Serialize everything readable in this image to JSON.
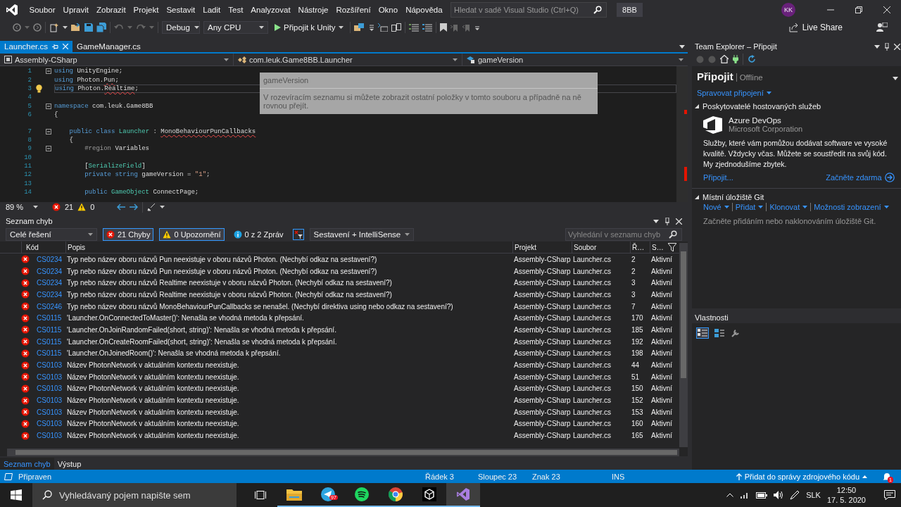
{
  "menu": {
    "items": [
      "Soubor",
      "Upravit",
      "Zobrazit",
      "Projekt",
      "Sestavit",
      "Ladit",
      "Test",
      "Analyzovat",
      "Nástroje",
      "Rozšíření",
      "Okno",
      "Nápověda"
    ]
  },
  "search": {
    "placeholder": "Hledat v sadě Visual Studio (Ctrl+Q)"
  },
  "solution": "8BB",
  "account": {
    "initials": "KK"
  },
  "toolbar": {
    "configuration": "Debug",
    "platform": "Any CPU",
    "run": "Připojit k Unity",
    "live_share": "Live Share"
  },
  "editor": {
    "tabs": [
      {
        "label": "Launcher.cs",
        "selected": true
      },
      {
        "label": "GameManager.cs",
        "selected": false
      }
    ],
    "nav": [
      "Assembly-CSharp",
      "com.leuk.Game8BB.Launcher",
      "gameVersion"
    ],
    "lines": [
      {
        "number": "1",
        "current": false,
        "fold": true,
        "tokens": [
          {
            "kind": "keyword",
            "text": "using"
          },
          {
            "kind": "plain",
            "text": " UnityEngine;"
          }
        ]
      },
      {
        "number": "2",
        "current": false,
        "fold": false,
        "tokens": [
          {
            "kind": "keyword",
            "text": "using"
          },
          {
            "kind": "plain",
            "text": " Photon."
          },
          {
            "kind": "unresolved",
            "text": "Pun"
          },
          {
            "kind": "plain",
            "text": ";"
          }
        ]
      },
      {
        "number": "3",
        "current": true,
        "fold": false,
        "tokens": [
          {
            "kind": "keyword",
            "text": "using"
          },
          {
            "kind": "plain",
            "text": " Photon."
          },
          {
            "kind": "unresolved",
            "text": "Realtime"
          },
          {
            "kind": "plain",
            "text": ";"
          }
        ]
      },
      {
        "number": "4",
        "current": false,
        "fold": false
      },
      {
        "number": "5",
        "current": false,
        "fold": true,
        "tokens": [
          {
            "kind": "keyword",
            "text": "namespace"
          },
          {
            "kind": "plain",
            "text": " com.leuk.Game8BB"
          }
        ]
      },
      {
        "number": "6",
        "current": false,
        "fold": false,
        "tokens": [
          {
            "kind": "plain",
            "text": "{"
          }
        ]
      },
      {
        "number": "7",
        "current": false,
        "fold": true,
        "tokens": [
          {
            "kind": "keyword",
            "text": "    public class "
          },
          {
            "kind": "type",
            "text": "Launcher"
          },
          {
            "kind": "plain",
            "text": " : "
          },
          {
            "kind": "unresolved",
            "text": "MonoBehaviourPunCallbacks"
          }
        ]
      },
      {
        "number": "8",
        "current": false,
        "fold": false,
        "tokens": [
          {
            "kind": "plain",
            "text": "    {"
          }
        ]
      },
      {
        "number": "9",
        "current": false,
        "fold": true,
        "tokens": [
          {
            "kind": "region",
            "text": "        #region"
          },
          {
            "kind": "plain",
            "text": " Variables"
          }
        ]
      },
      {
        "number": "10",
        "current": false,
        "fold": false
      },
      {
        "number": "11",
        "current": false,
        "fold": false,
        "tokens": [
          {
            "kind": "plain",
            "text": "        ["
          },
          {
            "kind": "type",
            "text": "SerializeField"
          },
          {
            "kind": "plain",
            "text": "]"
          }
        ]
      },
      {
        "number": "12",
        "current": false,
        "fold": false,
        "tokens": [
          {
            "kind": "keyword",
            "text": "        private string"
          },
          {
            "kind": "plain",
            "text": " gameVersion = "
          },
          {
            "kind": "string",
            "text": "\"1\""
          },
          {
            "kind": "plain",
            "text": ";"
          }
        ]
      },
      {
        "number": "13",
        "current": false,
        "fold": false
      },
      {
        "number": "14",
        "current": false,
        "fold": false,
        "tokens": [
          {
            "kind": "keyword",
            "text": "        public "
          },
          {
            "kind": "type",
            "text": "GameObject"
          },
          {
            "kind": "plain",
            "text": " ConnectPage;"
          }
        ]
      }
    ],
    "tooltip": {
      "title": "gameVersion",
      "text": "V rozevíracím seznamu si můžete zobrazit ostatní položky v tomto souboru a případně na ně rovnou přejít."
    },
    "zoom": "89 %",
    "errors": "21",
    "warnings": "0"
  },
  "error_list": {
    "title": "Seznam chyb",
    "scope": "Celé řešení",
    "filters": [
      {
        "kind": "error",
        "label": "21 Chyby",
        "selected": true
      },
      {
        "kind": "warning",
        "label": "0 Upozornění",
        "selected": true
      },
      {
        "kind": "info",
        "label": "0 z 2 Zpráv",
        "selected": false
      }
    ],
    "source": "Sestavení + IntelliSense",
    "search": {
      "placeholder": "Vyhledání v seznamu chyb"
    },
    "columns": [
      "Kód",
      "Popis",
      "Projekt",
      "Soubor",
      "Ř…",
      "S…"
    ],
    "rows": [
      {
        "code": "CS0234",
        "description": "Typ nebo název oboru názvů Pun neexistuje v oboru názvů Photon. (Nechybí odkaz na sestavení?)",
        "project": "Assembly-CSharp",
        "file": "Launcher.cs",
        "line": "2",
        "state": "Aktivní"
      },
      {
        "code": "CS0234",
        "description": "Typ nebo název oboru názvů Pun neexistuje v oboru názvů Photon. (Nechybí odkaz na sestavení?)",
        "project": "Assembly-CSharp",
        "file": "Launcher.cs",
        "line": "2",
        "state": "Aktivní"
      },
      {
        "code": "CS0234",
        "description": "Typ nebo název oboru názvů Realtime neexistuje v oboru názvů Photon. (Nechybí odkaz na sestavení?)",
        "project": "Assembly-CSharp",
        "file": "Launcher.cs",
        "line": "3",
        "state": "Aktivní"
      },
      {
        "code": "CS0234",
        "description": "Typ nebo název oboru názvů Realtime neexistuje v oboru názvů Photon. (Nechybí odkaz na sestavení?)",
        "project": "Assembly-CSharp",
        "file": "Launcher.cs",
        "line": "3",
        "state": "Aktivní"
      },
      {
        "code": "CS0246",
        "description": "Typ nebo název oboru názvů MonoBehaviourPunCallbacks se nenašel. (Nechybí direktiva using nebo odkaz na sestavení?)",
        "project": "Assembly-CSharp",
        "file": "Launcher.cs",
        "line": "7",
        "state": "Aktivní"
      },
      {
        "code": "CS0115",
        "description": "'Launcher.OnConnectedToMaster()': Nenašla se vhodná metoda k přepsání.",
        "project": "Assembly-CSharp",
        "file": "Launcher.cs",
        "line": "170",
        "state": "Aktivní"
      },
      {
        "code": "CS0115",
        "description": "'Launcher.OnJoinRandomFailed(short, string)': Nenašla se vhodná metoda k přepsání.",
        "project": "Assembly-CSharp",
        "file": "Launcher.cs",
        "line": "185",
        "state": "Aktivní"
      },
      {
        "code": "CS0115",
        "description": "'Launcher.OnCreateRoomFailed(short, string)': Nenašla se vhodná metoda k přepsání.",
        "project": "Assembly-CSharp",
        "file": "Launcher.cs",
        "line": "192",
        "state": "Aktivní"
      },
      {
        "code": "CS0115",
        "description": "'Launcher.OnJoinedRoom()': Nenašla se vhodná metoda k přepsání.",
        "project": "Assembly-CSharp",
        "file": "Launcher.cs",
        "line": "198",
        "state": "Aktivní"
      },
      {
        "code": "CS0103",
        "description": "Název PhotonNetwork v aktuálním kontextu neexistuje.",
        "project": "Assembly-CSharp",
        "file": "Launcher.cs",
        "line": "44",
        "state": "Aktivní"
      },
      {
        "code": "CS0103",
        "description": "Název PhotonNetwork v aktuálním kontextu neexistuje.",
        "project": "Assembly-CSharp",
        "file": "Launcher.cs",
        "line": "51",
        "state": "Aktivní"
      },
      {
        "code": "CS0103",
        "description": "Název PhotonNetwork v aktuálním kontextu neexistuje.",
        "project": "Assembly-CSharp",
        "file": "Launcher.cs",
        "line": "150",
        "state": "Aktivní"
      },
      {
        "code": "CS0103",
        "description": "Název PhotonNetwork v aktuálním kontextu neexistuje.",
        "project": "Assembly-CSharp",
        "file": "Launcher.cs",
        "line": "152",
        "state": "Aktivní"
      },
      {
        "code": "CS0103",
        "description": "Název PhotonNetwork v aktuálním kontextu neexistuje.",
        "project": "Assembly-CSharp",
        "file": "Launcher.cs",
        "line": "153",
        "state": "Aktivní"
      },
      {
        "code": "CS0103",
        "description": "Název PhotonNetwork v aktuálním kontextu neexistuje.",
        "project": "Assembly-CSharp",
        "file": "Launcher.cs",
        "line": "160",
        "state": "Aktivní"
      },
      {
        "code": "CS0103",
        "description": "Název PhotonNetwork v aktuálním kontextu neexistuje.",
        "project": "Assembly-CSharp",
        "file": "Launcher.cs",
        "line": "165",
        "state": "Aktivní"
      }
    ]
  },
  "bottom_tabs": [
    {
      "label": "Seznam chyb",
      "selected": true
    },
    {
      "label": "Výstup",
      "selected": false
    }
  ],
  "team_explorer": {
    "title": "Team Explorer – Připojit",
    "heading": "Připojit",
    "status": "Offline",
    "manage": "Spravovat připojení",
    "hosted": {
      "title": "Poskytovatelé hostovaných služeb",
      "provider": "Azure DevOps",
      "company": "Microsoft Corporation",
      "text": "Služby, které vám pomůžou dodávat software ve vysoké kvalitě. Vždycky včas. Můžete se soustředit na svůj kód. My zjednodušíme zbytek.",
      "connect": "Připojit...",
      "start": "Začněte zdarma"
    },
    "git": {
      "title": "Místní úložiště Git",
      "actions": [
        "Nové",
        "Přidat",
        "Klonovat",
        "Možnosti zobrazení"
      ],
      "text": "Začněte přidáním nebo naklonováním úložiště Git."
    }
  },
  "properties": {
    "title": "Vlastnosti"
  },
  "status_bar": {
    "message": "Připraven",
    "line": "Řádek 3",
    "column": "Sloupec 23",
    "char": "Znak 23",
    "mode": "INS",
    "source_control": "Přidat do správy zdrojového kódu",
    "notifications": "1"
  },
  "taskbar": {
    "search": {
      "placeholder": "Vyhledávaný pojem napište sem"
    },
    "apps": [
      {
        "kind": "explorer",
        "selected": false
      },
      {
        "kind": "telegram",
        "selected": false,
        "badge": "97"
      },
      {
        "kind": "spotify",
        "selected": false
      },
      {
        "kind": "chrome",
        "selected": false
      },
      {
        "kind": "unity",
        "selected": false
      },
      {
        "kind": "studio",
        "selected": true
      }
    ],
    "language": "SLK",
    "time": "12:50",
    "date": "17. 5. 2020"
  }
}
